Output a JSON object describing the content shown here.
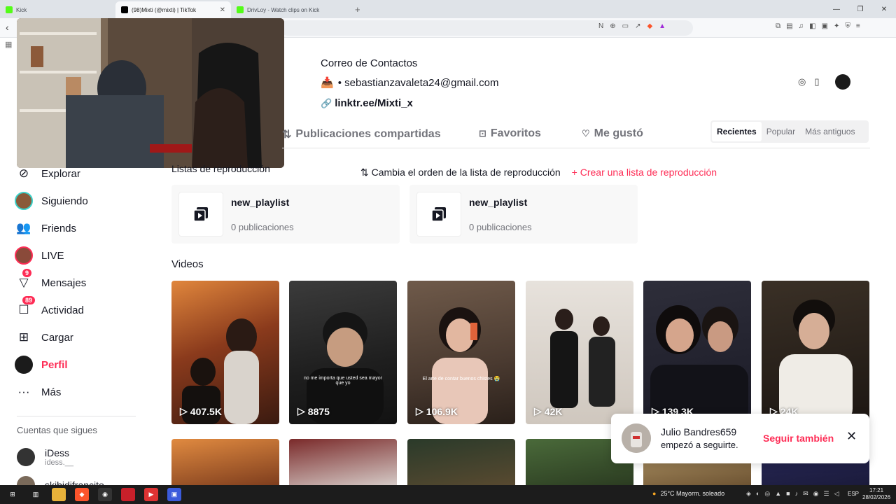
{
  "browser": {
    "tabs": [
      {
        "label": "Kick",
        "color": "#53fc18"
      },
      {
        "label": "(98)Mixti (@mixti) | TikTok",
        "color": "#000000"
      },
      {
        "label": "DrivLoy - Watch clips on Kick",
        "color": "#53fc18"
      }
    ],
    "new_tab": "+",
    "window_controls": [
      "—",
      "❐",
      "✕"
    ]
  },
  "profile": {
    "contact_title": "Correo de Contactos",
    "email_line": "• sebastianzavaleta24@gmail.com",
    "link": "linktr.ee/Mixti_x"
  },
  "tabs": {
    "shared": "Publicaciones compartidas",
    "favorites": "Favoritos",
    "liked": "Me gustó"
  },
  "sort": {
    "recent": "Recientes",
    "popular": "Popular",
    "oldest": "Más antiguos"
  },
  "playlists": {
    "title": "Listas de reproducción",
    "reorder": "Cambia el orden de la lista de reproducción",
    "create": "+ Crear una lista de reproducción",
    "items": [
      {
        "name": "new_playlist",
        "count": "0 publicaciones"
      },
      {
        "name": "new_playlist",
        "count": "0 publicaciones"
      }
    ]
  },
  "videos": {
    "title": "Videos",
    "items": [
      {
        "views": "407.5K",
        "caption": ""
      },
      {
        "views": "8875",
        "caption": "no me importa que usted sea mayor que yo"
      },
      {
        "views": "106.9K",
        "caption": "El arte de contar buenos chistes 😭"
      },
      {
        "views": "42K",
        "caption": ""
      },
      {
        "views": "139.3K",
        "caption": ""
      },
      {
        "views": "24K",
        "caption": ""
      }
    ]
  },
  "sidebar": {
    "items": [
      {
        "label": "Explorar",
        "icon": "compass-icon"
      },
      {
        "label": "Siguiendo",
        "icon": "following-avatar-icon"
      },
      {
        "label": "Friends",
        "icon": "friends-icon"
      },
      {
        "label": "LIVE",
        "icon": "live-avatar-icon"
      },
      {
        "label": "Mensajes",
        "icon": "messages-icon",
        "badge": "9"
      },
      {
        "label": "Actividad",
        "icon": "activity-icon",
        "badge": "89"
      },
      {
        "label": "Cargar",
        "icon": "upload-icon"
      },
      {
        "label": "Perfil",
        "icon": "profile-avatar-icon"
      },
      {
        "label": "Más",
        "icon": "more-icon"
      }
    ],
    "following_title": "Cuentas que sigues",
    "following": [
      {
        "name": "iDess",
        "handle": "idess.__"
      },
      {
        "name": "skibidifrancito",
        "handle": ""
      }
    ]
  },
  "notification": {
    "user": "Julio Bandres659",
    "message": "empezó a seguirte.",
    "action": "Seguir también"
  },
  "taskbar": {
    "weather": "25°C  Mayorm. soleado",
    "lang": "ESP",
    "time": "17:21",
    "date": "28/02/2026"
  },
  "colors": {
    "accent": "#fe2c55"
  }
}
